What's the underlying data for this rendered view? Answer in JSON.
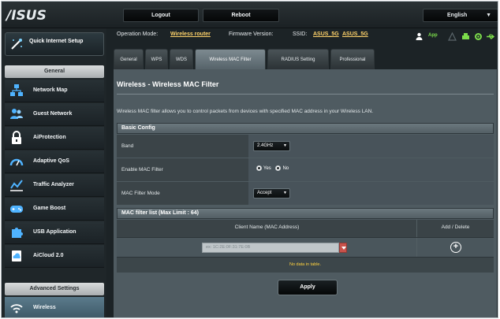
{
  "header": {
    "logo_text": "/ISUS",
    "logout_label": "Logout",
    "reboot_label": "Reboot",
    "language": "English"
  },
  "status": {
    "op_mode_label": "Operation Mode:",
    "op_mode_value": "Wireless router",
    "firmware_label": "Firmware Version:",
    "ssid_label": "SSID:",
    "ssid_1": "ASUS_5G",
    "ssid_2": "ASUS_5G",
    "app_label": "App"
  },
  "sidebar": {
    "quick_setup_label": "Quick Internet Setup",
    "general_heading": "General",
    "items": [
      {
        "label": "Network Map",
        "icon": "network-map-icon"
      },
      {
        "label": "Guest Network",
        "icon": "guest-network-icon"
      },
      {
        "label": "AiProtection",
        "icon": "lock-icon"
      },
      {
        "label": "Adaptive QoS",
        "icon": "speedometer-icon"
      },
      {
        "label": "Traffic Analyzer",
        "icon": "chart-icon"
      },
      {
        "label": "Game Boost",
        "icon": "gamepad-icon"
      },
      {
        "label": "USB Application",
        "icon": "puzzle-icon"
      },
      {
        "label": "AiCloud 2.0",
        "icon": "cloud-icon"
      }
    ],
    "advanced_heading": "Advanced Settings",
    "active_item": "Wireless"
  },
  "tabs": [
    {
      "label": "General"
    },
    {
      "label": "WPS"
    },
    {
      "label": "WDS"
    },
    {
      "label": "Wireless MAC Filter"
    },
    {
      "label": "RADIUS Setting"
    },
    {
      "label": "Professional"
    }
  ],
  "page": {
    "title": "Wireless - Wireless MAC Filter",
    "description": "Wireless MAC filter allows you to control packets from devices with specified MAC address in your Wireless LAN.",
    "basic_config": "Basic Config",
    "band_label": "Band",
    "band_value": "2.4GHz",
    "enable_label": "Enable MAC Filter",
    "yes_label": "Yes",
    "no_label": "No",
    "mode_label": "MAC Filter Mode",
    "mode_value": "Accept",
    "list_heading": "MAC filter list (Max Limit : 64)",
    "col_client": "Client Name (MAC Address)",
    "col_add": "Add / Delete",
    "mac_placeholder": "ex: 1C:2E:0F:31:7E:0B",
    "no_data": "No data in table.",
    "apply_label": "Apply"
  },
  "colors": {
    "accent_yellow": "#ffd23f",
    "active_blue": "#5b7b8c",
    "status_green": "#7cdc4b"
  }
}
